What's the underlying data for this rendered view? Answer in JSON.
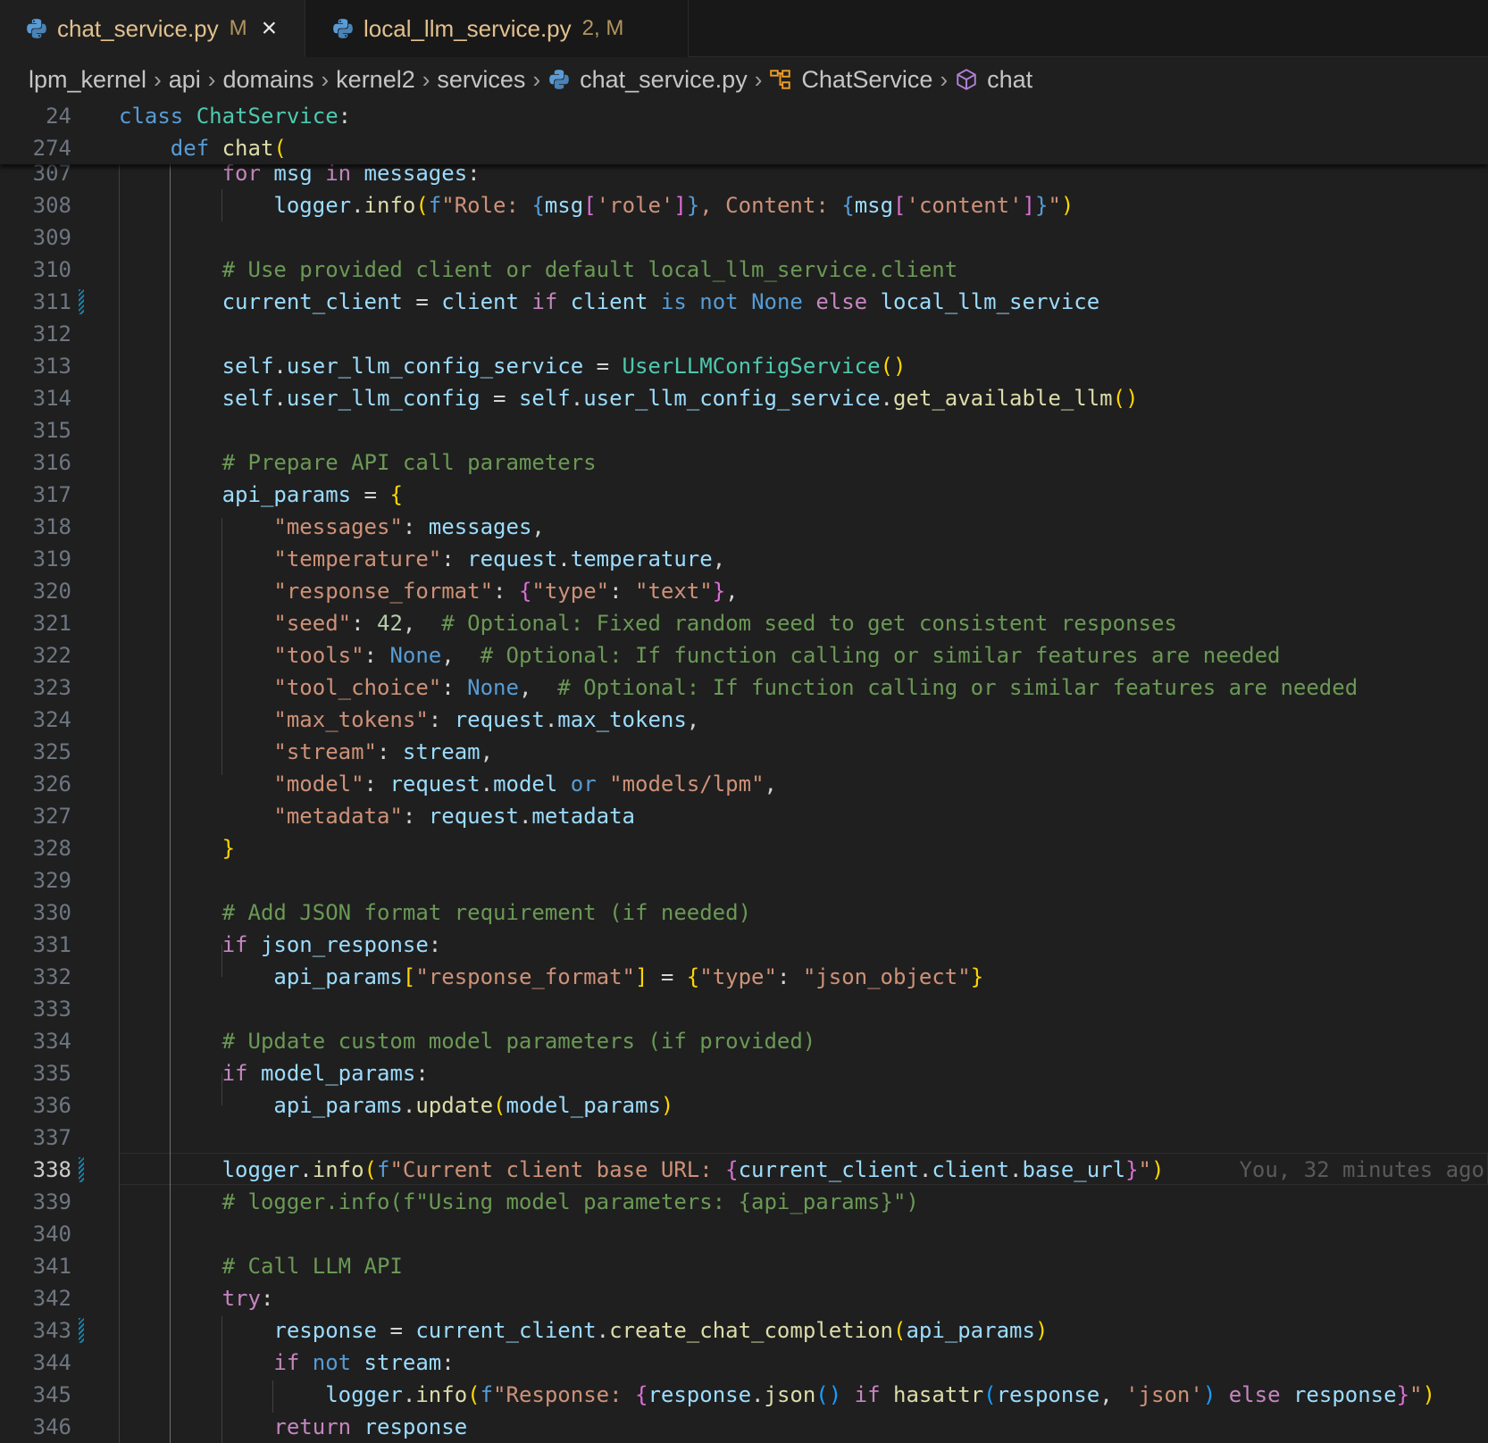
{
  "tabs": [
    {
      "name": "chat_service.py",
      "badge": "M",
      "close": "×"
    },
    {
      "name": "local_llm_service.py",
      "badge": "2, M"
    }
  ],
  "breadcrumbs": [
    "lpm_kernel",
    "api",
    "domains",
    "kernel2",
    "services",
    "chat_service.py",
    "ChatService",
    "chat"
  ],
  "blame_text": "You, 32 minutes ago",
  "icons": {
    "python": "python-file-icon",
    "class": "class-symbol-icon",
    "method": "method-symbol-icon",
    "chevron": "chevron-right-icon"
  },
  "colors": {
    "background": "#1f1f1f",
    "tabbar": "#181818",
    "modified": "#e2c08d",
    "gutter_change": "#1b81a8"
  },
  "sticky_lines": [
    {
      "num": "24",
      "segs": [
        [
          "k",
          "class "
        ],
        [
          "t",
          "ChatService"
        ],
        [
          "p",
          ":"
        ]
      ]
    },
    {
      "num": "274",
      "segs": [
        [
          "p",
          "    "
        ],
        [
          "k",
          "def "
        ],
        [
          "f",
          "chat"
        ],
        [
          "b1",
          "("
        ]
      ]
    }
  ],
  "lines": [
    {
      "num": "307",
      "segs": [
        [
          "p",
          "        "
        ],
        [
          "cf",
          "for "
        ],
        [
          "v",
          "msg "
        ],
        [
          "cf",
          "in "
        ],
        [
          "v",
          "messages"
        ],
        [
          "p",
          ":"
        ]
      ]
    },
    {
      "num": "308",
      "segs": [
        [
          "p",
          "            "
        ],
        [
          "v",
          "logger"
        ],
        [
          "p",
          "."
        ],
        [
          "f",
          "info"
        ],
        [
          "b1",
          "("
        ],
        [
          "k",
          "f"
        ],
        [
          "s",
          "\"Role: "
        ],
        [
          "k",
          "{"
        ],
        [
          "v",
          "msg"
        ],
        [
          "b2",
          "["
        ],
        [
          "s",
          "'role'"
        ],
        [
          "b2",
          "]"
        ],
        [
          "k",
          "}"
        ],
        [
          "s",
          ", Content: "
        ],
        [
          "k",
          "{"
        ],
        [
          "v",
          "msg"
        ],
        [
          "b2",
          "["
        ],
        [
          "s",
          "'content'"
        ],
        [
          "b2",
          "]"
        ],
        [
          "k",
          "}"
        ],
        [
          "s",
          "\""
        ],
        [
          "b1",
          ")"
        ]
      ]
    },
    {
      "num": "309",
      "segs": []
    },
    {
      "num": "310",
      "segs": [
        [
          "p",
          "        "
        ],
        [
          "c",
          "# Use provided client or default local_llm_service.client"
        ]
      ]
    },
    {
      "num": "311",
      "gutter": true,
      "segs": [
        [
          "p",
          "        "
        ],
        [
          "v",
          "current_client "
        ],
        [
          "p",
          "= "
        ],
        [
          "v",
          "client "
        ],
        [
          "cf",
          "if "
        ],
        [
          "v",
          "client "
        ],
        [
          "k",
          "is not None "
        ],
        [
          "cf",
          "else "
        ],
        [
          "v",
          "local_llm_service"
        ]
      ]
    },
    {
      "num": "312",
      "segs": []
    },
    {
      "num": "313",
      "segs": [
        [
          "p",
          "        "
        ],
        [
          "v",
          "self"
        ],
        [
          "p",
          "."
        ],
        [
          "v",
          "user_llm_config_service "
        ],
        [
          "p",
          "= "
        ],
        [
          "t",
          "UserLLMConfigService"
        ],
        [
          "b1",
          "()"
        ]
      ]
    },
    {
      "num": "314",
      "segs": [
        [
          "p",
          "        "
        ],
        [
          "v",
          "self"
        ],
        [
          "p",
          "."
        ],
        [
          "v",
          "user_llm_config "
        ],
        [
          "p",
          "= "
        ],
        [
          "v",
          "self"
        ],
        [
          "p",
          "."
        ],
        [
          "v",
          "user_llm_config_service"
        ],
        [
          "p",
          "."
        ],
        [
          "f",
          "get_available_llm"
        ],
        [
          "b1",
          "()"
        ]
      ]
    },
    {
      "num": "315",
      "segs": []
    },
    {
      "num": "316",
      "segs": [
        [
          "p",
          "        "
        ],
        [
          "c",
          "# Prepare API call parameters"
        ]
      ]
    },
    {
      "num": "317",
      "segs": [
        [
          "p",
          "        "
        ],
        [
          "v",
          "api_params "
        ],
        [
          "p",
          "= "
        ],
        [
          "b1",
          "{"
        ]
      ]
    },
    {
      "num": "318",
      "segs": [
        [
          "p",
          "            "
        ],
        [
          "s",
          "\"messages\""
        ],
        [
          "p",
          ": "
        ],
        [
          "v",
          "messages"
        ],
        [
          "p",
          ","
        ]
      ]
    },
    {
      "num": "319",
      "segs": [
        [
          "p",
          "            "
        ],
        [
          "s",
          "\"temperature\""
        ],
        [
          "p",
          ": "
        ],
        [
          "v",
          "request"
        ],
        [
          "p",
          "."
        ],
        [
          "v",
          "temperature"
        ],
        [
          "p",
          ","
        ]
      ]
    },
    {
      "num": "320",
      "segs": [
        [
          "p",
          "            "
        ],
        [
          "s",
          "\"response_format\""
        ],
        [
          "p",
          ": "
        ],
        [
          "b2",
          "{"
        ],
        [
          "s",
          "\"type\""
        ],
        [
          "p",
          ": "
        ],
        [
          "s",
          "\"text\""
        ],
        [
          "b2",
          "}"
        ],
        [
          "p",
          ","
        ]
      ]
    },
    {
      "num": "321",
      "segs": [
        [
          "p",
          "            "
        ],
        [
          "s",
          "\"seed\""
        ],
        [
          "p",
          ": "
        ],
        [
          "n",
          "42"
        ],
        [
          "p",
          ",  "
        ],
        [
          "c",
          "# Optional: Fixed random seed to get consistent responses"
        ]
      ]
    },
    {
      "num": "322",
      "segs": [
        [
          "p",
          "            "
        ],
        [
          "s",
          "\"tools\""
        ],
        [
          "p",
          ": "
        ],
        [
          "k",
          "None"
        ],
        [
          "p",
          ",  "
        ],
        [
          "c",
          "# Optional: If function calling or similar features are needed"
        ]
      ]
    },
    {
      "num": "323",
      "segs": [
        [
          "p",
          "            "
        ],
        [
          "s",
          "\"tool_choice\""
        ],
        [
          "p",
          ": "
        ],
        [
          "k",
          "None"
        ],
        [
          "p",
          ",  "
        ],
        [
          "c",
          "# Optional: If function calling or similar features are needed"
        ]
      ]
    },
    {
      "num": "324",
      "segs": [
        [
          "p",
          "            "
        ],
        [
          "s",
          "\"max_tokens\""
        ],
        [
          "p",
          ": "
        ],
        [
          "v",
          "request"
        ],
        [
          "p",
          "."
        ],
        [
          "v",
          "max_tokens"
        ],
        [
          "p",
          ","
        ]
      ]
    },
    {
      "num": "325",
      "segs": [
        [
          "p",
          "            "
        ],
        [
          "s",
          "\"stream\""
        ],
        [
          "p",
          ": "
        ],
        [
          "v",
          "stream"
        ],
        [
          "p",
          ","
        ]
      ]
    },
    {
      "num": "326",
      "segs": [
        [
          "p",
          "            "
        ],
        [
          "s",
          "\"model\""
        ],
        [
          "p",
          ": "
        ],
        [
          "v",
          "request"
        ],
        [
          "p",
          "."
        ],
        [
          "v",
          "model "
        ],
        [
          "k",
          "or "
        ],
        [
          "s",
          "\"models/lpm\""
        ],
        [
          "p",
          ","
        ]
      ]
    },
    {
      "num": "327",
      "segs": [
        [
          "p",
          "            "
        ],
        [
          "s",
          "\"metadata\""
        ],
        [
          "p",
          ": "
        ],
        [
          "v",
          "request"
        ],
        [
          "p",
          "."
        ],
        [
          "v",
          "metadata"
        ]
      ]
    },
    {
      "num": "328",
      "segs": [
        [
          "p",
          "        "
        ],
        [
          "b1",
          "}"
        ]
      ]
    },
    {
      "num": "329",
      "segs": []
    },
    {
      "num": "330",
      "segs": [
        [
          "p",
          "        "
        ],
        [
          "c",
          "# Add JSON format requirement (if needed)"
        ]
      ]
    },
    {
      "num": "331",
      "segs": [
        [
          "p",
          "        "
        ],
        [
          "cf",
          "if "
        ],
        [
          "v",
          "json_response"
        ],
        [
          "p",
          ":"
        ]
      ]
    },
    {
      "num": "332",
      "segs": [
        [
          "p",
          "            "
        ],
        [
          "v",
          "api_params"
        ],
        [
          "b1",
          "["
        ],
        [
          "s",
          "\"response_format\""
        ],
        [
          "b1",
          "]"
        ],
        [
          "p",
          " = "
        ],
        [
          "b1",
          "{"
        ],
        [
          "s",
          "\"type\""
        ],
        [
          "p",
          ": "
        ],
        [
          "s",
          "\"json_object\""
        ],
        [
          "b1",
          "}"
        ]
      ]
    },
    {
      "num": "333",
      "segs": []
    },
    {
      "num": "334",
      "segs": [
        [
          "p",
          "        "
        ],
        [
          "c",
          "# Update custom model parameters (if provided)"
        ]
      ]
    },
    {
      "num": "335",
      "segs": [
        [
          "p",
          "        "
        ],
        [
          "cf",
          "if "
        ],
        [
          "v",
          "model_params"
        ],
        [
          "p",
          ":"
        ]
      ]
    },
    {
      "num": "336",
      "segs": [
        [
          "p",
          "            "
        ],
        [
          "v",
          "api_params"
        ],
        [
          "p",
          "."
        ],
        [
          "f",
          "update"
        ],
        [
          "b1",
          "("
        ],
        [
          "v",
          "model_params"
        ],
        [
          "b1",
          ")"
        ]
      ]
    },
    {
      "num": "337",
      "segs": []
    },
    {
      "num": "338",
      "active": true,
      "gutter": true,
      "blame": true,
      "segs": [
        [
          "p",
          "        "
        ],
        [
          "v",
          "logger"
        ],
        [
          "p",
          "."
        ],
        [
          "f",
          "info"
        ],
        [
          "b1",
          "("
        ],
        [
          "k",
          "f"
        ],
        [
          "s",
          "\"Current client base URL: "
        ],
        [
          "b2",
          "{"
        ],
        [
          "v",
          "current_client"
        ],
        [
          "p",
          "."
        ],
        [
          "v",
          "client"
        ],
        [
          "p",
          "."
        ],
        [
          "v",
          "base_url"
        ],
        [
          "b2",
          "}"
        ],
        [
          "s",
          "\""
        ],
        [
          "b1",
          ")"
        ]
      ]
    },
    {
      "num": "339",
      "segs": [
        [
          "p",
          "        "
        ],
        [
          "c",
          "# logger.info(f\"Using model parameters: {api_params}\")"
        ]
      ]
    },
    {
      "num": "340",
      "segs": []
    },
    {
      "num": "341",
      "segs": [
        [
          "p",
          "        "
        ],
        [
          "c",
          "# Call LLM API"
        ]
      ]
    },
    {
      "num": "342",
      "segs": [
        [
          "p",
          "        "
        ],
        [
          "cf",
          "try"
        ],
        [
          "p",
          ":"
        ]
      ]
    },
    {
      "num": "343",
      "gutter": true,
      "segs": [
        [
          "p",
          "            "
        ],
        [
          "v",
          "response "
        ],
        [
          "p",
          "= "
        ],
        [
          "v",
          "current_client"
        ],
        [
          "p",
          "."
        ],
        [
          "f",
          "create_chat_completion"
        ],
        [
          "b1",
          "("
        ],
        [
          "v",
          "api_params"
        ],
        [
          "b1",
          ")"
        ]
      ]
    },
    {
      "num": "344",
      "segs": [
        [
          "p",
          "            "
        ],
        [
          "cf",
          "if "
        ],
        [
          "k",
          "not "
        ],
        [
          "v",
          "stream"
        ],
        [
          "p",
          ":"
        ]
      ]
    },
    {
      "num": "345",
      "segs": [
        [
          "p",
          "                "
        ],
        [
          "v",
          "logger"
        ],
        [
          "p",
          "."
        ],
        [
          "f",
          "info"
        ],
        [
          "b1",
          "("
        ],
        [
          "k",
          "f"
        ],
        [
          "s",
          "\"Response: "
        ],
        [
          "b2",
          "{"
        ],
        [
          "v",
          "response"
        ],
        [
          "p",
          "."
        ],
        [
          "f",
          "json"
        ],
        [
          "b3",
          "()"
        ],
        [
          "cf",
          " if "
        ],
        [
          "f",
          "hasattr"
        ],
        [
          "b3",
          "("
        ],
        [
          "v",
          "response"
        ],
        [
          "p",
          ", "
        ],
        [
          "s",
          "'json'"
        ],
        [
          "b3",
          ")"
        ],
        [
          "cf",
          " else "
        ],
        [
          "v",
          "response"
        ],
        [
          "b2",
          "}"
        ],
        [
          "s",
          "\""
        ],
        [
          "b1",
          ")"
        ]
      ]
    },
    {
      "num": "346",
      "segs": [
        [
          "p",
          "            "
        ],
        [
          "cf",
          "return "
        ],
        [
          "v",
          "response"
        ]
      ]
    }
  ]
}
